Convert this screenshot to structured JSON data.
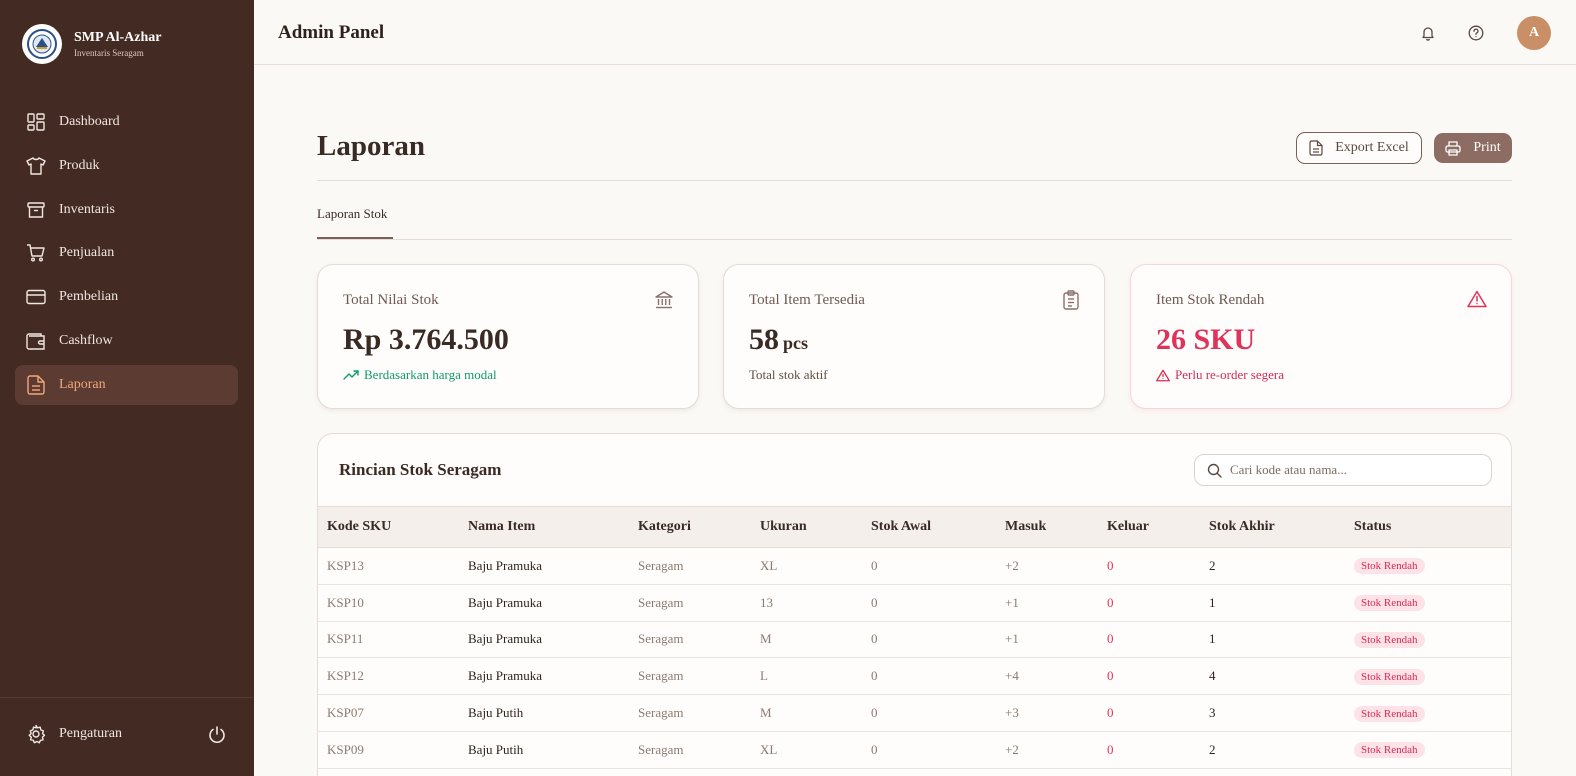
{
  "brand": {
    "name": "SMP Al-Azhar",
    "subtitle": "Inventaris Seragam"
  },
  "sidebar": {
    "items": [
      {
        "label": "Dashboard",
        "icon": "dashboard-grid-icon"
      },
      {
        "label": "Produk",
        "icon": "shirt-icon"
      },
      {
        "label": "Inventaris",
        "icon": "archive-box-icon"
      },
      {
        "label": "Penjualan",
        "icon": "shopping-cart-icon"
      },
      {
        "label": "Pembelian",
        "icon": "credit-card-icon"
      },
      {
        "label": "Cashflow",
        "icon": "wallet-icon"
      },
      {
        "label": "Laporan",
        "icon": "document-icon",
        "active": true
      }
    ],
    "settings_label": "Pengaturan"
  },
  "header": {
    "title": "Admin Panel",
    "avatar_initial": "A"
  },
  "page": {
    "title": "Laporan",
    "export_label": "Export Excel",
    "print_label": "Print",
    "tab_label": "Laporan Stok"
  },
  "cards": [
    {
      "label": "Total Nilai Stok",
      "value": "Rp 3.764.500",
      "sub": "Berdasarkan harga modal",
      "icon": "bank-icon"
    },
    {
      "label": "Total Item Tersedia",
      "value": "58",
      "unit": "pcs",
      "sub": "Total stok aktif",
      "icon": "clipboard-list-icon"
    },
    {
      "label": "Item Stok Rendah",
      "value": "26 SKU",
      "sub": "Perlu re-order segera",
      "icon": "alert-triangle-icon"
    }
  ],
  "table": {
    "title": "Rincian Stok Seragam",
    "search_placeholder": "Cari kode atau nama...",
    "columns": [
      "Kode SKU",
      "Nama Item",
      "Kategori",
      "Ukuran",
      "Stok Awal",
      "Masuk",
      "Keluar",
      "Stok Akhir",
      "Status"
    ],
    "rows": [
      [
        "KSP13",
        "Baju Pramuka",
        "Seragam",
        "XL",
        "0",
        "+2",
        "0",
        "2",
        "Stok Rendah"
      ],
      [
        "KSP10",
        "Baju Pramuka",
        "Seragam",
        "13",
        "0",
        "+1",
        "0",
        "1",
        "Stok Rendah"
      ],
      [
        "KSP11",
        "Baju Pramuka",
        "Seragam",
        "M",
        "0",
        "+1",
        "0",
        "1",
        "Stok Rendah"
      ],
      [
        "KSP12",
        "Baju Pramuka",
        "Seragam",
        "L",
        "0",
        "+4",
        "0",
        "4",
        "Stok Rendah"
      ],
      [
        "KSP07",
        "Baju Putih",
        "Seragam",
        "M",
        "0",
        "+3",
        "0",
        "3",
        "Stok Rendah"
      ],
      [
        "KSP09",
        "Baju Putih",
        "Seragam",
        "XL",
        "0",
        "+2",
        "0",
        "2",
        "Stok Rendah"
      ]
    ]
  },
  "colors": {
    "sidebar": "#432a23",
    "accent": "#8d6d63",
    "active_text": "#f1a77a",
    "success": "#0f9b6e",
    "danger": "#e0335c"
  }
}
